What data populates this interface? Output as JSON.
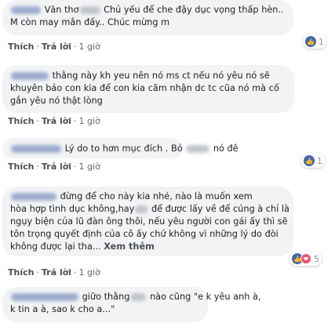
{
  "comments": [
    {
      "lines": [
        "Văn thơ",
        "Chủ yếu để che đậy dục vọng thấp hèn..",
        "M còn may mắn đấy.. Chúc mừng m"
      ],
      "reactions": {
        "like": true,
        "love": false,
        "count": "1"
      }
    },
    {
      "lines": [
        "thằng này kh yeu nên nó ms ct nếu nó yêu nó sẽ",
        "khuyên bảo con kia để con kia cãm nhận dc tc cũa nó mà cố",
        "gắn yêu nó thật lòng"
      ],
      "reactions": null
    },
    {
      "lines": [
        "Lý do to hơn mục đích . Bỏ",
        "nó đê"
      ],
      "reactions": {
        "like": true,
        "love": false,
        "count": "1"
      }
    },
    {
      "lines": [
        "đừng để cho này kia nhé, nào là muốn xem",
        "hòa hợp tình dục không,hay",
        "để được lấy về để cúng à chỉ là",
        "ngụy biện của lũ đàn ông thôi, nếu yêu người con gái ấy thì sẽ",
        "tôn trọng quyết định của cô ấy chứ không vì những lý do đòi",
        "không được lại tha...",
        "Xem thêm"
      ],
      "reactions": {
        "like": true,
        "love": true,
        "count": "5"
      }
    },
    {
      "lines": [
        "giữo thằng",
        "nào cũng \"e k yêu anh à,",
        "k tin a à, sao k cho a...\""
      ],
      "reactions": null
    }
  ],
  "actions": {
    "like_label": "Thích",
    "reply_label": "Trả lời",
    "separator": "·",
    "time": "1 giờ"
  }
}
